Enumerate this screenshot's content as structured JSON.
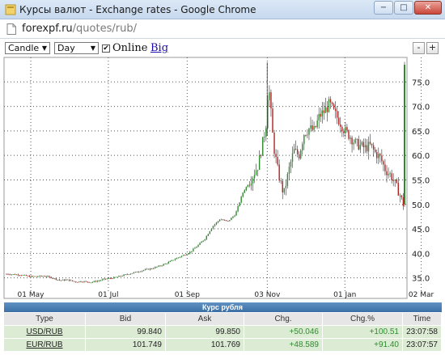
{
  "window": {
    "title": "Курсы валют - Exchange rates - Google Chrome",
    "minimize": "−",
    "maximize": "□",
    "close": "✕"
  },
  "address": {
    "host": "forexpf.ru",
    "path": "/quotes/rub/"
  },
  "toolbar": {
    "chart_type": "Candle",
    "period": "Day",
    "online_checked": true,
    "online_label": "Online",
    "big_label": "Big",
    "zoom_out": "-",
    "zoom_in": "+"
  },
  "chart_data": {
    "type": "candlestick",
    "x_ticks": [
      "01 May",
      "01 Jul",
      "01 Sep",
      "03 Nov",
      "01 Jan",
      "02 Mar"
    ],
    "y_ticks": [
      35.0,
      40.0,
      45.0,
      50.0,
      55.0,
      60.0,
      65.0,
      70.0,
      75.0
    ],
    "ylim": [
      32.3,
      80
    ],
    "up_color": "#2e8b2e",
    "down_color": "#b22222",
    "grid": "dotted",
    "series": [
      {
        "values": [
          [
            0,
            35.8
          ],
          [
            6,
            35.7
          ],
          [
            12,
            35.6
          ],
          [
            18,
            35.3
          ],
          [
            24,
            35.3
          ],
          [
            30,
            35.4
          ],
          [
            36,
            35.0
          ],
          [
            42,
            34.5
          ],
          [
            48,
            34.6
          ],
          [
            54,
            34.2
          ],
          [
            60,
            34.3
          ],
          [
            66,
            34.1
          ],
          [
            72,
            34.4
          ],
          [
            78,
            34.8
          ],
          [
            84,
            35.0
          ],
          [
            90,
            35.4
          ],
          [
            96,
            35.8
          ],
          [
            102,
            36.2
          ],
          [
            108,
            36.6
          ],
          [
            114,
            36.9
          ],
          [
            120,
            37.4
          ],
          [
            126,
            38.0
          ],
          [
            132,
            38.8
          ],
          [
            138,
            39.5
          ],
          [
            144,
            40.2
          ],
          [
            150,
            41.5
          ],
          [
            156,
            43.0
          ],
          [
            162,
            45.5
          ],
          [
            168,
            47.0
          ],
          [
            174,
            46.5
          ],
          [
            180,
            48.0
          ],
          [
            186,
            52.5
          ],
          [
            192,
            55.0
          ],
          [
            198,
            58.0
          ],
          [
            204,
            66.0
          ],
          [
            206,
            75.0
          ],
          [
            210,
            62.0
          ],
          [
            214,
            56.0
          ],
          [
            218,
            52.0
          ],
          [
            222,
            57.0
          ],
          [
            226,
            61.0
          ],
          [
            230,
            60.0
          ],
          [
            234,
            64.5
          ],
          [
            238,
            65.5
          ],
          [
            242,
            65.0
          ],
          [
            246,
            68.0
          ],
          [
            250,
            69.0
          ],
          [
            254,
            70.5
          ],
          [
            258,
            68.5
          ],
          [
            262,
            67.0
          ],
          [
            266,
            65.0
          ],
          [
            270,
            64.0
          ],
          [
            274,
            62.5
          ],
          [
            278,
            62.0
          ],
          [
            282,
            61.5
          ],
          [
            286,
            62.0
          ],
          [
            290,
            60.5
          ],
          [
            294,
            59.5
          ],
          [
            298,
            57.0
          ],
          [
            302,
            56.0
          ],
          [
            306,
            54.0
          ],
          [
            310,
            51.5
          ],
          [
            312,
            50.0
          ],
          [
            313,
            78.5
          ]
        ]
      }
    ]
  },
  "rates": {
    "caption": "Курс рубля",
    "headers": [
      "Type",
      "Bid",
      "Ask",
      "Chg.",
      "Chg.%",
      "Time"
    ],
    "rows": [
      [
        "USD/RUB",
        "99.840",
        "99.850",
        "+50.046",
        "+100.51",
        "23:07:58"
      ],
      [
        "EUR/RUB",
        "101.749",
        "101.769",
        "+48.589",
        "+91.40",
        "23:07:57"
      ]
    ]
  }
}
